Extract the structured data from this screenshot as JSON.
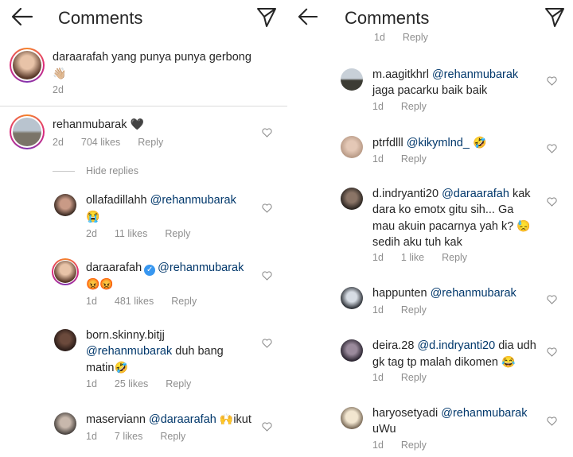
{
  "header": {
    "title": "Comments"
  },
  "left": {
    "caption": {
      "user": "daraarafah",
      "text": " yang punya punya gerbong",
      "emoji": "👋🏼",
      "time": "2d"
    },
    "top_comment": {
      "user": "rehanmubarak",
      "emoji": "🖤",
      "time": "2d",
      "likes": "704 likes",
      "reply": "Reply"
    },
    "hide_replies": "Hide replies",
    "replies": [
      {
        "user": "ollafadillahh",
        "mention": "@rehanmubarak",
        "text": "",
        "emoji": "😭",
        "time": "2d",
        "likes": "11 likes",
        "reply": "Reply"
      },
      {
        "user": "daraarafah",
        "mention": "@rehanmubarak",
        "text": "",
        "emoji": "😡😡",
        "time": "1d",
        "likes": "481 likes",
        "reply": "Reply"
      },
      {
        "user": "born.skinny.bitjj",
        "mention": "@rehanmubarak",
        "text": " duh bang matin",
        "emoji": "🤣",
        "time": "1d",
        "likes": "25 likes",
        "reply": "Reply"
      },
      {
        "user": "maservian​n",
        "mention": "@daraarafah",
        "text": " ",
        "emoji": "🙌",
        "text2": "ikut",
        "time": "1d",
        "likes": "7 likes",
        "reply": "Reply"
      }
    ]
  },
  "right": {
    "partial_meta": {
      "time": "1d",
      "reply": "Reply"
    },
    "comments": [
      {
        "user": "m.aagitkhrl",
        "mention": "@rehanmubarak",
        "text": " jaga pacarku baik baik",
        "emoji": "",
        "time": "1d",
        "likes": "",
        "reply": "Reply"
      },
      {
        "user": "ptrfdlll",
        "mention": "@kikymlnd_",
        "text": " ",
        "emoji": "🤣",
        "time": "1d",
        "likes": "",
        "reply": "Reply"
      },
      {
        "user": "d.indryanti20",
        "mention": "@daraarafah",
        "text": " kak dara ko emotx gitu sih... Ga mau akuin pacarnya yah k? ",
        "emoji": "😓",
        "text2": " sedih aku tuh kak",
        "time": "1d",
        "likes": "1 like",
        "reply": "Reply"
      },
      {
        "user": "happunten",
        "mention": "@rehanmubarak",
        "text": "",
        "emoji": "",
        "time": "1d",
        "likes": "",
        "reply": "Reply"
      },
      {
        "user": "deira.28",
        "mention": "@d.indryanti20",
        "text": " dia udh gk tag tp malah dikomen ",
        "emoji": "😂",
        "time": "1d",
        "likes": "",
        "reply": "Reply"
      },
      {
        "user": "haryosetyadi",
        "mention": "@rehanmubarak",
        "text": " uWu",
        "emoji": "",
        "time": "1d",
        "likes": "",
        "reply": "Reply"
      }
    ]
  },
  "colors": {
    "mention": "#00376b",
    "meta": "#8e8e8e",
    "text": "#262626",
    "verified": "#3897f0"
  },
  "icons": {
    "back": "arrow-left-icon",
    "send": "paper-plane-icon",
    "like": "heart-outline-icon"
  }
}
